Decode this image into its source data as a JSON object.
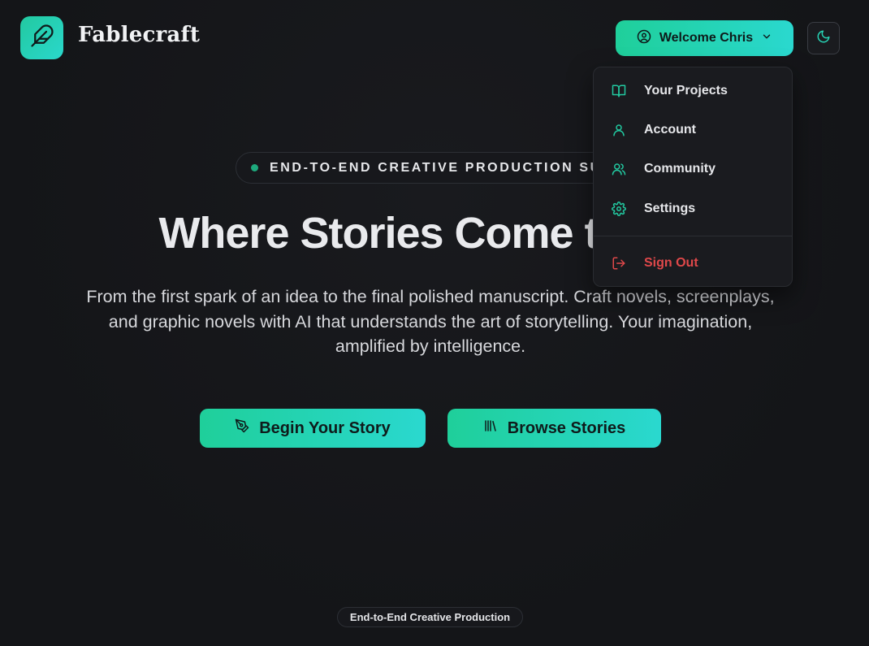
{
  "header": {
    "brand": "Fablecraft",
    "logo_icon": "feather-icon",
    "welcome_label": "Welcome Chris",
    "theme_icon": "moon-icon"
  },
  "hero": {
    "pill_text": "END-TO-END CREATIVE PRODUCTION SUITE",
    "title": "Where Stories Come to Life",
    "subtitle": "From the first spark of an idea to the final polished manuscript. Craft novels, screenplays, and graphic novels with AI that understands the art of storytelling. Your imagination, amplified by intelligence.",
    "cta_begin": "Begin Your Story",
    "cta_browse": "Browse Stories"
  },
  "footer": {
    "badge": "End-to-End Creative Production"
  },
  "menu": {
    "items": [
      {
        "label": "Your Projects",
        "icon": "book-open-icon"
      },
      {
        "label": "Account",
        "icon": "user-icon"
      },
      {
        "label": "Community",
        "icon": "users-icon"
      },
      {
        "label": "Settings",
        "icon": "gear-icon"
      }
    ],
    "sign_out": {
      "label": "Sign Out",
      "icon": "log-out-icon"
    }
  },
  "colors": {
    "accent_start": "#1fcf9a",
    "accent_end": "#2ad8cf",
    "background": "#141518",
    "menu_icon": "#22c9a0",
    "danger": "#e0484a"
  }
}
